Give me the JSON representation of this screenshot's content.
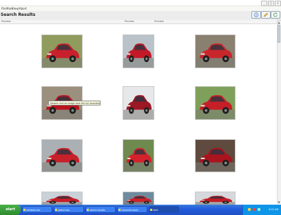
{
  "window": {
    "title": ""
  },
  "menu": [
    "File",
    "Mark",
    "View/Abort"
  ],
  "header": {
    "title": "Search Results"
  },
  "toolbar": [
    {
      "name": "info-icon"
    },
    {
      "name": "edit-icon"
    },
    {
      "name": "refresh-icon"
    }
  ],
  "columns": [
    "Preview",
    "Preview",
    "Preview"
  ],
  "tooltip": "Double click on image view the full resolution image",
  "thumbnails": [
    {
      "name": "red-car-1",
      "body": "#c8202c",
      "bg": "#8f9c5e"
    },
    {
      "name": "red-car-2",
      "body": "#c21a27",
      "bg": "#b9c2c9"
    },
    {
      "name": "red-car-3",
      "body": "#c9262b",
      "bg": "#8a8070"
    },
    {
      "name": "red-car-4",
      "body": "#b8161f",
      "bg": "#9b8f7d"
    },
    {
      "name": "red-car-5",
      "body": "#9b1824",
      "bg": "#e6e8ea"
    },
    {
      "name": "red-car-6",
      "body": "#c51f28",
      "bg": "#7fa05a"
    },
    {
      "name": "red-car-7",
      "body": "#c8202a",
      "bg": "#aab0b4"
    },
    {
      "name": "red-car-8",
      "body": "#d4222d",
      "bg": "#6f8a4f"
    },
    {
      "name": "red-car-9",
      "body": "#a9141e",
      "bg": "#5e4a3e"
    },
    {
      "name": "red-car-10",
      "body": "#c71d27",
      "bg": "#c9d2d8"
    },
    {
      "name": "red-car-11",
      "body": "#cd2229",
      "bg": "#6f8c9e"
    },
    {
      "name": "red-car-12",
      "body": "#c41c24",
      "bg": "#d6d9dc"
    }
  ],
  "taskbar": {
    "start": "start",
    "buttons": [
      "windows.doc",
      "patent.doc",
      "search-results",
      "Computer-tools",
      "start"
    ],
    "clock": "4:02 AM"
  }
}
